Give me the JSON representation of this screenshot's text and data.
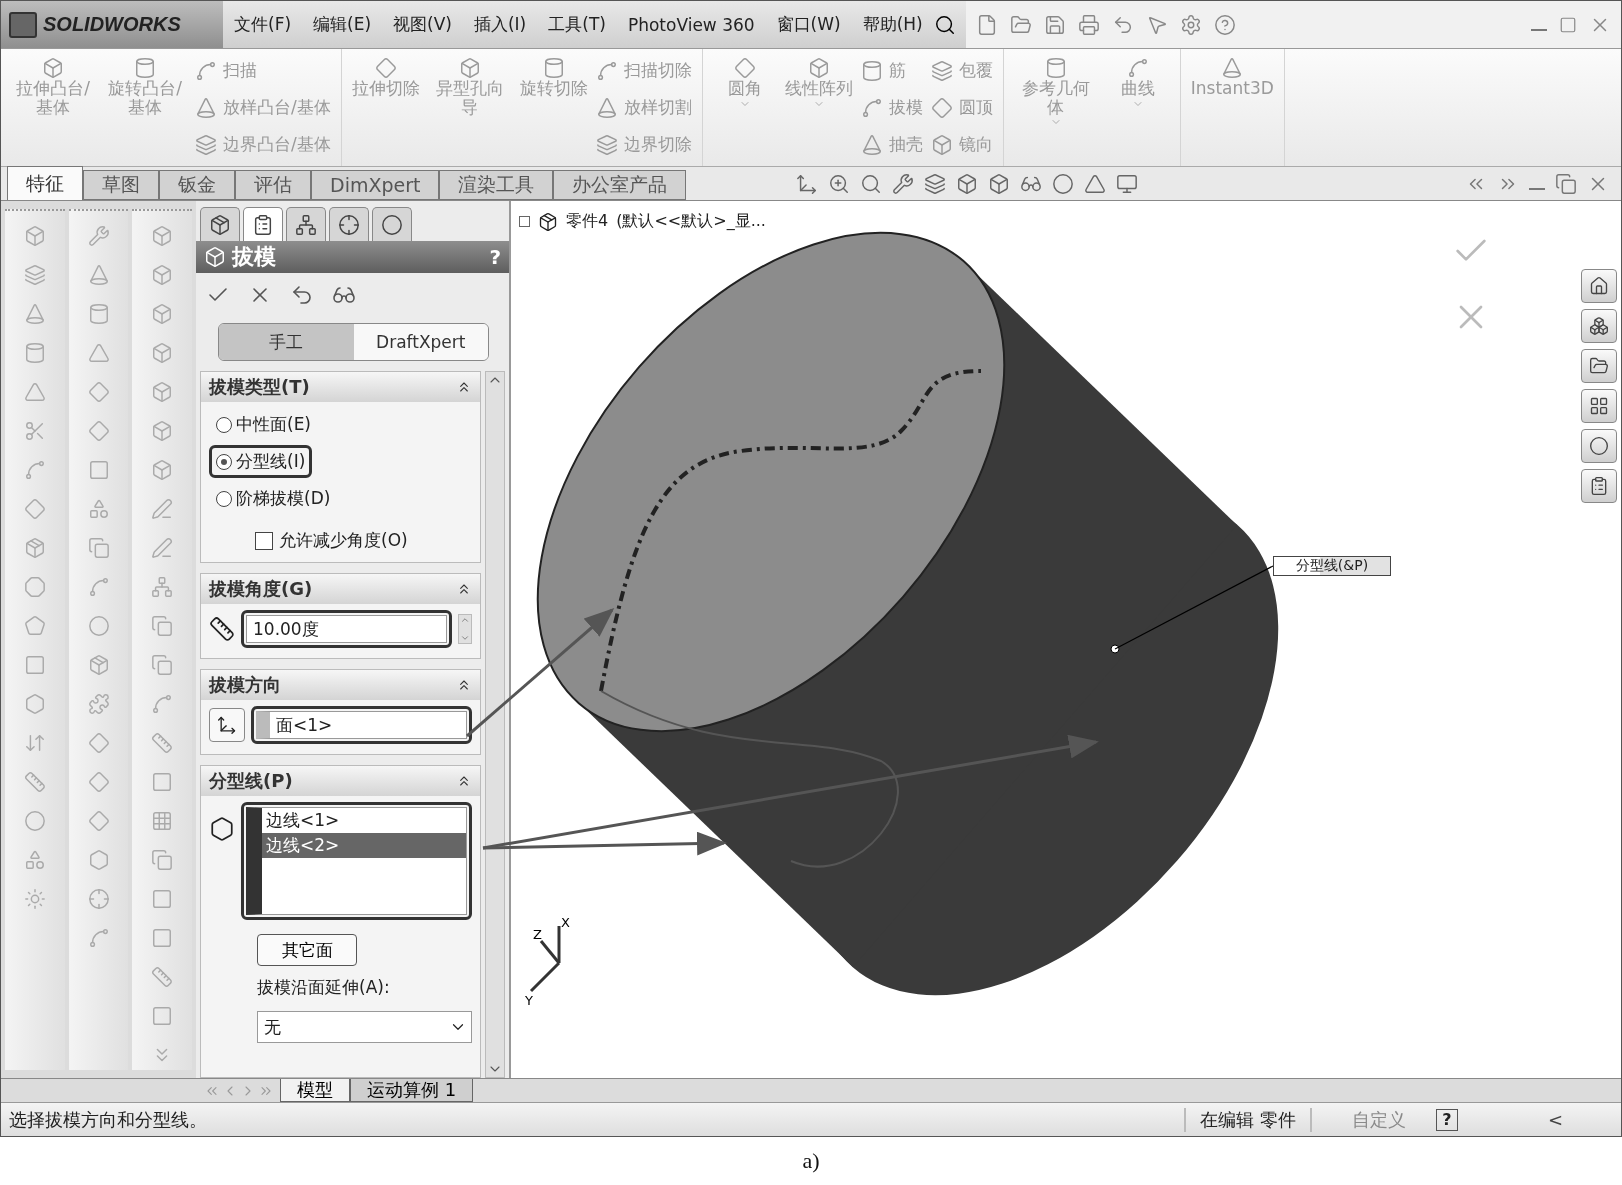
{
  "app": {
    "logo": "SOLIDWORKS"
  },
  "menu": [
    "文件(F)",
    "编辑(E)",
    "视图(V)",
    "插入(I)",
    "工具(T)",
    "PhotoView 360",
    "窗口(W)",
    "帮助(H)"
  ],
  "ribbon": [
    {
      "tools": [
        {
          "kind": "large",
          "label": "拉伸凸台/基体",
          "dropdown": false
        },
        {
          "kind": "large",
          "label": "旋转凸台/基体",
          "dropdown": false
        },
        {
          "kind": "stack",
          "items": [
            "扫描",
            "放样凸台/基体",
            "边界凸台/基体"
          ]
        }
      ]
    },
    {
      "tools": [
        {
          "kind": "large",
          "label": "拉伸切除",
          "dropdown": false
        },
        {
          "kind": "large",
          "label": "异型孔向导",
          "dropdown": false
        },
        {
          "kind": "large",
          "label": "旋转切除",
          "dropdown": false
        },
        {
          "kind": "stack",
          "items": [
            "扫描切除",
            "放样切割",
            "边界切除"
          ]
        }
      ]
    },
    {
      "tools": [
        {
          "kind": "large",
          "label": "圆角",
          "dropdown": true
        },
        {
          "kind": "large",
          "label": "线性阵列",
          "dropdown": true
        },
        {
          "kind": "stack",
          "items": [
            "筋",
            "拔模",
            "抽壳"
          ]
        },
        {
          "kind": "stack",
          "items": [
            "包覆",
            "圆顶",
            "镜向"
          ]
        }
      ]
    },
    {
      "tools": [
        {
          "kind": "large",
          "label": "参考几何体",
          "dropdown": true
        },
        {
          "kind": "large",
          "label": "曲线",
          "dropdown": true
        }
      ]
    },
    {
      "tools": [
        {
          "kind": "large",
          "label": "Instant3D",
          "dropdown": false
        }
      ]
    }
  ],
  "command_tabs": [
    {
      "label": "特征",
      "selected": true
    },
    {
      "label": "草图",
      "selected": false
    },
    {
      "label": "钣金",
      "selected": false
    },
    {
      "label": "评估",
      "selected": false
    },
    {
      "label": "DimXpert",
      "selected": false
    },
    {
      "label": "渲染工具",
      "selected": false
    },
    {
      "label": "办公室产品",
      "selected": false
    }
  ],
  "property_manager": {
    "tabs": [
      {
        "selected": false
      },
      {
        "selected": true
      },
      {
        "selected": false
      },
      {
        "selected": false
      },
      {
        "selected": false
      }
    ],
    "title": "拔模",
    "help": "?",
    "modes": [
      {
        "label": "手工",
        "selected": true
      },
      {
        "label": "DraftXpert",
        "selected": false
      }
    ],
    "sections": [
      {
        "kind": "type",
        "title": "拔模类型(T)",
        "options": [
          {
            "label": "中性面(E)",
            "selected": false
          },
          {
            "label": "分型线(I)",
            "selected": true
          },
          {
            "label": "阶梯拔模(D)",
            "selected": false
          }
        ],
        "checkbox": {
          "label": "允许减少角度(O)",
          "checked": false
        }
      },
      {
        "kind": "angle",
        "title": "拔模角度(G)",
        "value": "10.00度"
      },
      {
        "kind": "direction",
        "title": "拔模方向",
        "value": "面<1>"
      },
      {
        "kind": "parting",
        "title": "分型线(P)",
        "items": [
          {
            "label": "边线<1>",
            "selected": false
          },
          {
            "label": "边线<2>",
            "selected": true
          }
        ],
        "button": "其它面",
        "extend_label": "拔模沿面延伸(A):",
        "extend_value": "无"
      }
    ]
  },
  "viewport": {
    "tree": {
      "part": "零件4",
      "config": "(默认<<默认>_显..."
    },
    "callout": "分型线(&P)",
    "axes": {
      "x": "X",
      "y": "Y",
      "z": "Z"
    }
  },
  "bottom_tabs": [
    {
      "label": "模型",
      "selected": true
    },
    {
      "label": "运动算例 1",
      "selected": false
    }
  ],
  "status_bar": {
    "message": "选择拔模方向和分型线。",
    "mode": "在编辑 零件",
    "custom": "自定义",
    "help": "?",
    "collapse": "<"
  },
  "caption": "a)"
}
